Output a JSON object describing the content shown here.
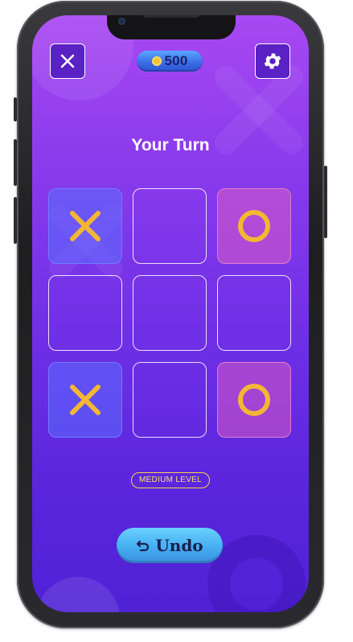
{
  "header": {
    "coins": "500"
  },
  "status": {
    "turn_text": "Your Turn"
  },
  "board": {
    "cells": [
      "X",
      "",
      "O",
      "",
      "",
      "",
      "X",
      "",
      "O"
    ]
  },
  "level": {
    "label": "MEDIUM LEVEL"
  },
  "actions": {
    "undo_label": "Undo"
  },
  "colors": {
    "background_top": "#a848f2",
    "background_bottom": "#4f22d6",
    "x_mark": "#f5b733",
    "o_mark": "#f5b733",
    "x_cell": "#5a6eff",
    "o_cell": "#ee64be",
    "undo_button": "#45aef0"
  },
  "icons": {
    "close": "close-icon",
    "settings": "gear-icon",
    "coin": "coin-icon",
    "undo": "undo-arrow-icon"
  }
}
